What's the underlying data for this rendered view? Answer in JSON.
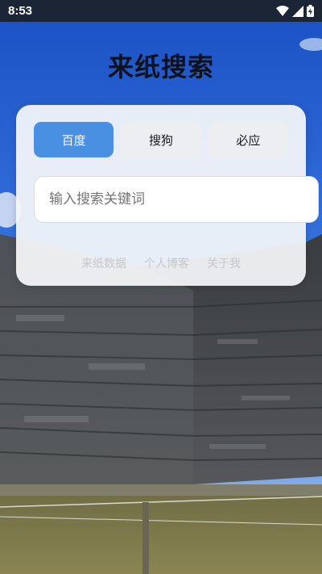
{
  "status_bar": {
    "time": "8:53",
    "icons": [
      "wifi-icon",
      "signal-icon",
      "battery-charging-icon"
    ]
  },
  "app": {
    "title": "来纸搜索"
  },
  "engines": {
    "items": [
      {
        "label": "百度",
        "active": true
      },
      {
        "label": "搜狗",
        "active": false
      },
      {
        "label": "必应",
        "active": false
      }
    ]
  },
  "search": {
    "value": "",
    "placeholder": "输入搜索关键词"
  },
  "footer": {
    "links": [
      {
        "label": "来纸数据"
      },
      {
        "label": "个人博客"
      },
      {
        "label": "关于我"
      }
    ]
  },
  "colors": {
    "accent": "#4a90e2",
    "status_bar": "#1c2535",
    "title": "#0f1218",
    "footer_link": "#c4c7cd"
  }
}
